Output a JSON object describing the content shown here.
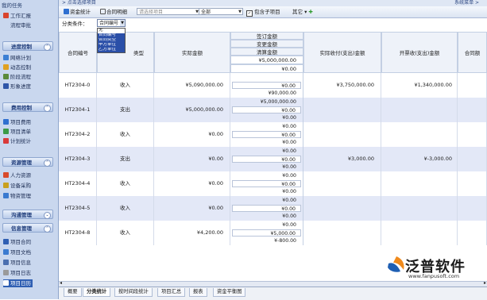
{
  "sidebar": {
    "top_label": "我的任务",
    "groups": [
      {
        "label": "进度控制"
      },
      {
        "label": "费用控制"
      },
      {
        "label": "资源管理"
      },
      {
        "label": "沟通管理"
      },
      {
        "label": "信息管理"
      }
    ],
    "items": [
      {
        "label": "工作汇报"
      },
      {
        "label": "流程审批"
      },
      {
        "label": "网络计划"
      },
      {
        "label": "动态控制"
      },
      {
        "label": "阶段流程"
      },
      {
        "label": "形象进度"
      },
      {
        "label": "项目费用"
      },
      {
        "label": "项目清单"
      },
      {
        "label": "计划统计"
      },
      {
        "label": "人力资源"
      },
      {
        "label": "设备采购"
      },
      {
        "label": "物资管理"
      },
      {
        "label": "项目合同"
      },
      {
        "label": "项目文档"
      },
      {
        "label": "项目信息"
      },
      {
        "label": "项目日志"
      },
      {
        "label": "项目日历"
      }
    ]
  },
  "breadcrumb": {
    "path": "> 点击选择项目",
    "menu": "系统菜单 >"
  },
  "toolbar": {
    "fund_stats": "资金统计",
    "contract_detail": "合同明细",
    "project_select": "请选择项目",
    "filter_all": "全部",
    "include_sub": "包含子项目",
    "other": "其它"
  },
  "grid": {
    "condition_label": "分类条件：",
    "condition_value": "合同编号",
    "condition_options": [
      "无",
      "合同编号",
      "合同类型",
      "甲方单位",
      "乙方单位"
    ],
    "headers": {
      "contract_no": "合同编号",
      "type": "类型",
      "actual_amount": "实际金额",
      "signed": "签订金额",
      "changed": "变更金额",
      "settled": "清算金额",
      "received": "实际收付(支出)金额",
      "invoiced": "开票收(支出)金额",
      "contract_amount": "合同额"
    },
    "rows": [
      {
        "no": "HT2304-0",
        "type": "收入",
        "actual": "¥5,090,000.00",
        "sub": [
          "¥5,000,000.00",
          "¥0.00",
          "¥90,000.00"
        ],
        "received": "¥3,750,000.00",
        "invoiced": "¥1,340,000.00"
      },
      {
        "no": "HT2304-1",
        "type": "支出",
        "actual": "¥5,000,000.00",
        "sub": [
          "¥5,000,000.00",
          "¥0.00",
          "¥0.00"
        ],
        "received": "",
        "invoiced": ""
      },
      {
        "no": "HT2304-2",
        "type": "收入",
        "actual": "¥0.00",
        "sub": [
          "¥0.00",
          "¥0.00",
          "¥0.00"
        ],
        "received": "",
        "invoiced": ""
      },
      {
        "no": "HT2304-3",
        "type": "支出",
        "actual": "¥0.00",
        "sub": [
          "¥0.00",
          "¥0.00",
          "¥0.00"
        ],
        "received": "¥3,000.00",
        "invoiced": "¥-3,000.00"
      },
      {
        "no": "HT2304-4",
        "type": "收入",
        "actual": "¥0.00",
        "sub": [
          "¥0.00",
          "¥0.00",
          "¥0.00"
        ],
        "received": "",
        "invoiced": ""
      },
      {
        "no": "HT2304-5",
        "type": "收入",
        "actual": "¥0.00",
        "sub": [
          "¥0.00",
          "¥0.00",
          "¥0.00"
        ],
        "received": "",
        "invoiced": ""
      },
      {
        "no": "HT2304-8",
        "type": "收入",
        "actual": "¥4,200.00",
        "sub": [
          "¥0.00",
          "¥5,000.00",
          "¥-800.00"
        ],
        "received": "",
        "invoiced": ""
      }
    ]
  },
  "tabs": [
    "概要",
    "分类统计",
    "按时间段统计",
    "项目汇总",
    "报表",
    "资金平衡图"
  ],
  "logo": {
    "name": "泛普软件",
    "url": "www.fanpusoft.com"
  },
  "colors": {
    "sidebar_bg": "#c9d7ee",
    "row_alt": "#e3e8f7",
    "selection": "#2a4fa8",
    "logo_orange": "#f08a1c",
    "logo_blue": "#1f5fb3"
  }
}
